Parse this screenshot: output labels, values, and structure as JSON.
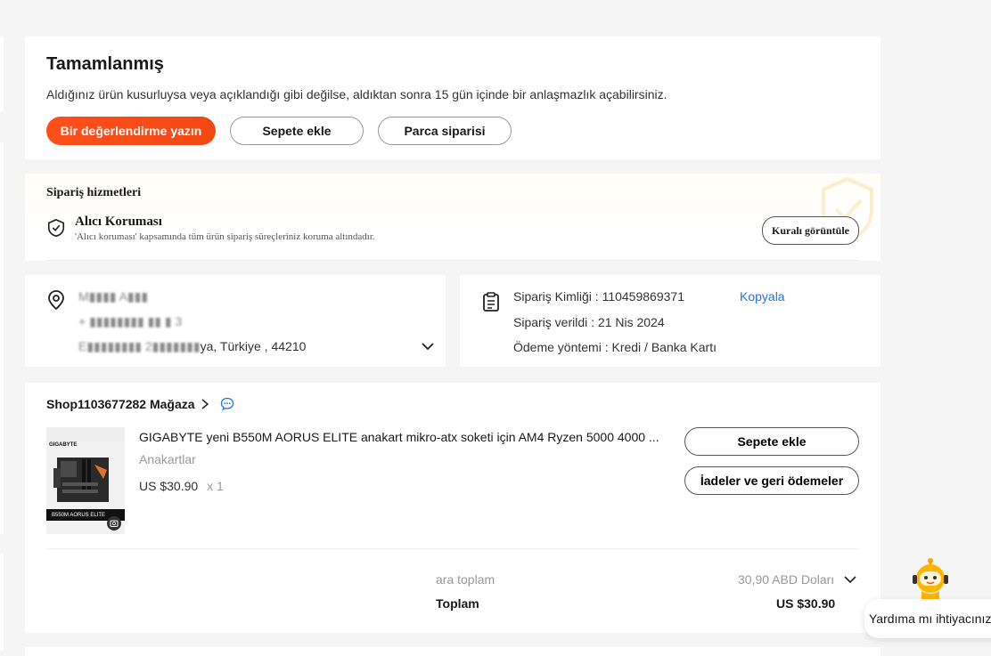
{
  "status": {
    "title": "Tamamlanmış",
    "description": "Aldığınız ürün kusurluysa veya açıklandığı gibi değilse, aldıktan sonra 15 gün içinde bir anlaşmazlık açabilirsiniz.",
    "buttons": {
      "review": "Bir değerlendirme yazın",
      "add_to_cart": "Sepete ekle",
      "parts_order": "Parca siparisi"
    }
  },
  "services": {
    "title": "Sipariş hizmetleri",
    "protection_name": "Alıcı Koruması",
    "protection_desc": "'Alıcı koruması' kapsamında tüm ürün sipariş süreçleriniz koruma altındadır.",
    "view_rule": "Kuralı görüntüle"
  },
  "address": {
    "name": "M▮▮▮▮ A▮▮▮",
    "phone": "+ ▮▮▮▮▮▮▮▮ ▮▮ ▮ 3",
    "line_hidden": "E▮▮▮▮▮▮▮▮ 2▮▮▮▮▮▮▮",
    "line_visible": "ya, Türkiye , 44210"
  },
  "order_info": {
    "id_label": "Sipariş Kimliği : 110459869371",
    "copy": "Kopyala",
    "placed": "Sipariş verildi : 21 Nis 2024",
    "payment": "Ödeme yöntemi : Kredi / Banka Kartı"
  },
  "product": {
    "shop_name": "Shop1103677282 Mağaza",
    "title": "GIGABYTE yeni B550M AORUS ELITE anakart mikro-atx soketi için AM4 Ryzen 5000 4000 ...",
    "category": "Anakartlar",
    "price": "US $30.90",
    "qty": "x 1",
    "image_brand": "GIGABYTE",
    "image_model": "B550M AORUS ELITE",
    "add_to_cart": "Sepete ekle",
    "returns": "İadeler ve geri ödemeler"
  },
  "summary": {
    "subtotal_label": "ara toplam",
    "subtotal_value": "30,90 ABD Doları",
    "total_label": "Toplam",
    "total_value": "US $30.90"
  },
  "help": {
    "text": "Yardıma mı ihtiyacınız"
  }
}
